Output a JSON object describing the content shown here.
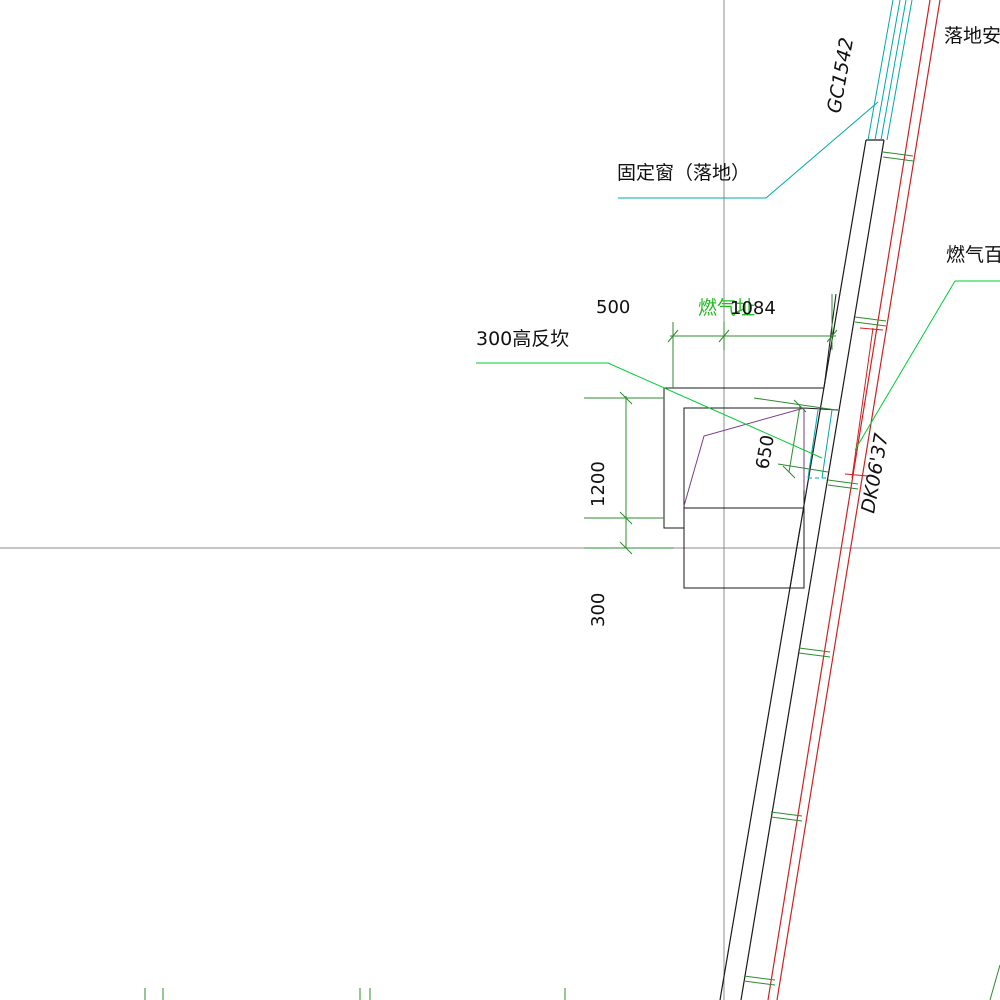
{
  "labels": {
    "top_right": "落地安",
    "window_code": "GC1542",
    "fixed_window": "固定窗（落地）",
    "gas_louver": "燃气百",
    "gas_area": "燃气址",
    "curb": "300高反坎",
    "dim_500": "500",
    "dim_1084": "1084",
    "dim_650": "650",
    "dim_1200": "1200",
    "dim_300": "300",
    "door_code": "DK06'37"
  },
  "colors": {
    "line": "#1a1a1a",
    "axis": "#8c8c8c",
    "dimension": "#2e8b2e",
    "green": "#00cc33",
    "cyan": "#00a8a8",
    "red": "#cc2222",
    "purple": "#7a3a8a",
    "label_green": "#22bb22"
  }
}
